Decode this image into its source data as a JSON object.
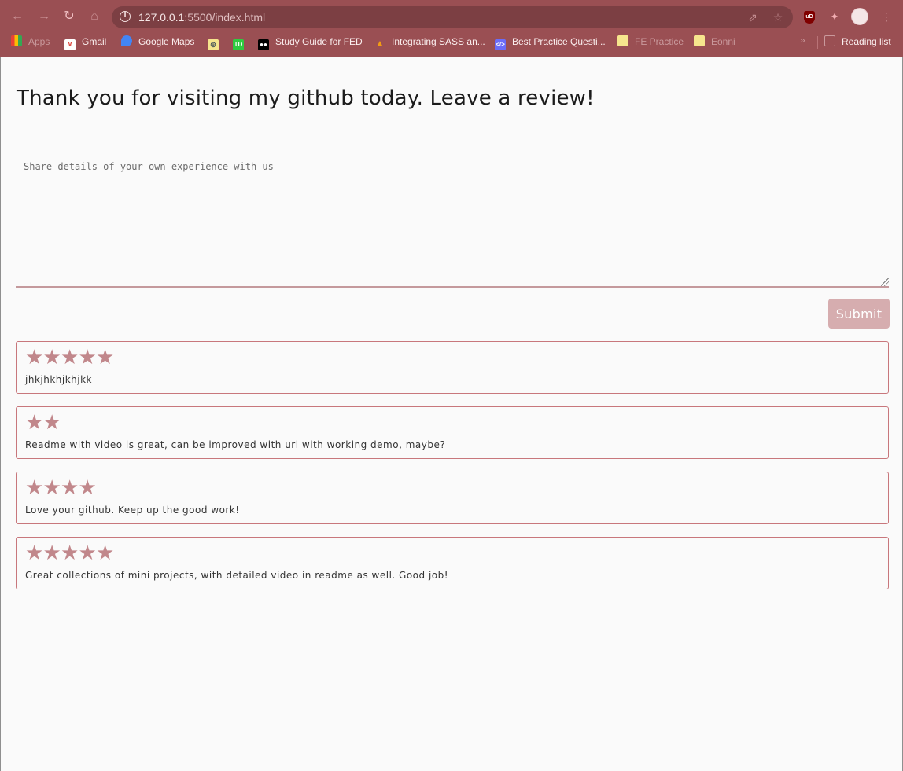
{
  "browser": {
    "url_host": "127.0.0.1",
    "url_rest": ":5500/index.html",
    "bookmarks": [
      {
        "label": "Apps",
        "icon": "apps-grid-icon"
      },
      {
        "label": "Gmail",
        "icon": "gmail-icon"
      },
      {
        "label": "Google Maps",
        "icon": "google-maps-icon"
      },
      {
        "label": "",
        "icon": "bookmark-favicon-icon"
      },
      {
        "label": "",
        "icon": "td-icon"
      },
      {
        "label": "Study Guide for FED",
        "icon": "medium-icon"
      },
      {
        "label": "Integrating SASS an...",
        "icon": "fire-icon"
      },
      {
        "label": "Best Practice Questi...",
        "icon": "code-icon"
      },
      {
        "label": "FE Practice",
        "icon": "folder-icon"
      },
      {
        "label": "Eonni",
        "icon": "folder-icon"
      }
    ],
    "reading_list": "Reading list"
  },
  "page": {
    "heading": "Thank you for visiting my github today. Leave a review!",
    "textarea_placeholder": "Share details of your own experience with us",
    "submit_label": "Submit"
  },
  "reviews": [
    {
      "rating": 5,
      "text": "jhkjhkhjkhjkk"
    },
    {
      "rating": 2,
      "text": "Readme with video is great, can be improved with url with working demo, maybe?"
    },
    {
      "rating": 4,
      "text": "Love your github. Keep up the good work!"
    },
    {
      "rating": 5,
      "text": "Great collections of mini projects, with detailed video in readme as well. Good job!"
    }
  ],
  "colors": {
    "chrome": "#9a4f53",
    "star": "#c1878b",
    "card_border": "#c8777c",
    "submit_bg": "#d6adaf"
  }
}
